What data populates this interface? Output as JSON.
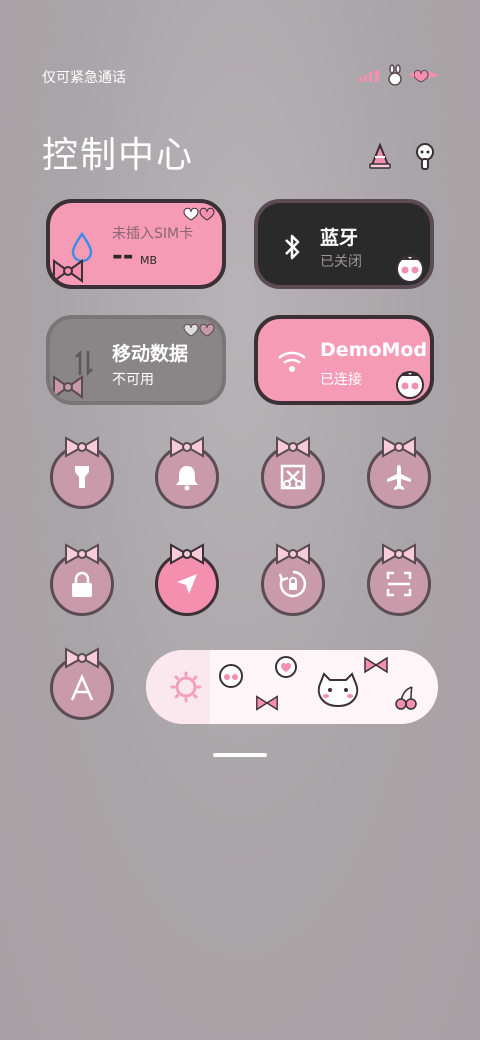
{
  "status_bar": {
    "carrier_text": "仅可紧急通话"
  },
  "header": {
    "title": "控制中心"
  },
  "tiles": {
    "data_usage": {
      "label": "未插入SIM卡",
      "value": "--",
      "unit": "MB"
    },
    "bluetooth": {
      "label": "蓝牙",
      "status": "已关闭"
    },
    "mobile_data": {
      "label": "移动数据",
      "status": "不可用"
    },
    "wifi": {
      "label": "DemoMod",
      "status": "已连接"
    }
  },
  "quick_toggles": [
    {
      "name": "flashlight",
      "icon": "flashlight-icon",
      "active": false
    },
    {
      "name": "sound",
      "icon": "bell-icon",
      "active": false
    },
    {
      "name": "screenshot",
      "icon": "scissors-icon",
      "active": false
    },
    {
      "name": "airplane-mode",
      "icon": "airplane-icon",
      "active": false
    },
    {
      "name": "lock-screen",
      "icon": "lock-icon",
      "active": false
    },
    {
      "name": "location",
      "icon": "location-arrow-icon",
      "active": true
    },
    {
      "name": "rotation-lock",
      "icon": "rotation-lock-icon",
      "active": false
    },
    {
      "name": "scan",
      "icon": "scan-icon",
      "active": false
    },
    {
      "name": "text-size",
      "icon": "font-a-icon",
      "active": false
    }
  ],
  "brightness": {
    "icon": "sun-icon",
    "level": 0.22
  },
  "colors": {
    "accent_pink": "#f59bb6",
    "dark_tile": "#2b2a2b",
    "grey_tile": "#8a8687",
    "border": "#3a3035"
  }
}
